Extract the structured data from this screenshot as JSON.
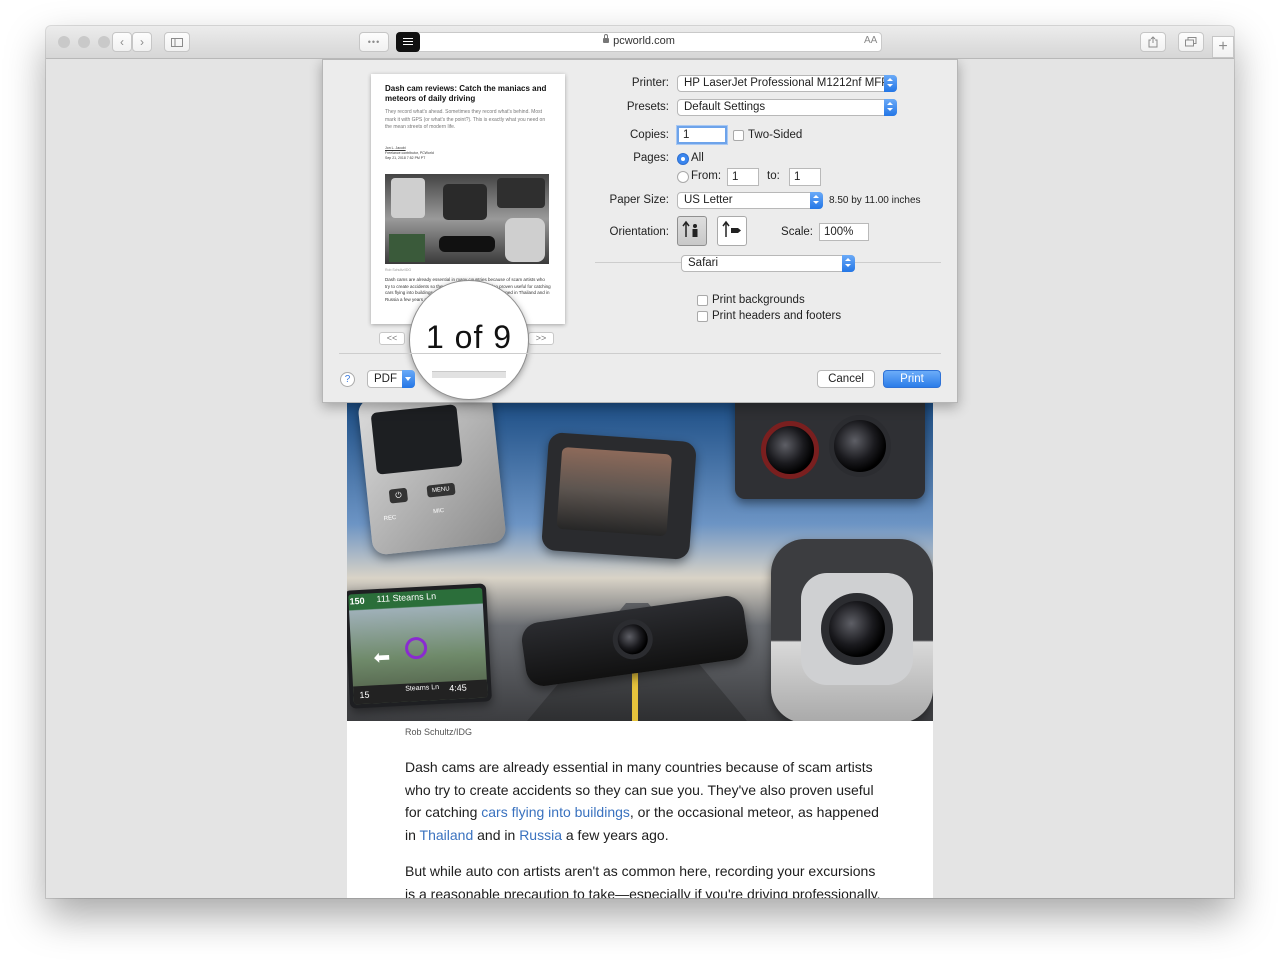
{
  "browser": {
    "url": "pcworld.com",
    "text_size_label": "AA",
    "more_label": "•••",
    "new_tab_label": "+"
  },
  "print_dialog": {
    "preview": {
      "title": "Dash cam reviews: Catch the maniacs and meteors of daily driving",
      "subtitle": "They record what's ahead. Sometimes they record what's behind. Most mark it with GPS (or what's the point?). This is exactly what you need on the mean streets of modern life.",
      "author": "Jon L. Jacobi",
      "author_role": "Freelance contributor, PCWorld",
      "date": "Sep 21, 2018 7:52 PM PT",
      "image_credit": "Rob Schultz/IDG",
      "body": "Dash cams are already essential in many countries because of scam artists who try to create accidents so they can sue you. They've also proven useful for catching cars flying into buildings, or the occasional meteor, as happened in Thailand and in Russia a few years ago."
    },
    "page_indicator": "1 of 9",
    "prev_label": "<<",
    "next_label": ">>",
    "printer_label": "Printer:",
    "printer_value": "HP LaserJet Professional M1212nf MFP",
    "presets_label": "Presets:",
    "presets_value": "Default Settings",
    "copies_label": "Copies:",
    "copies_value": "1",
    "two_sided_label": "Two-Sided",
    "pages_label": "Pages:",
    "pages_all_label": "All",
    "pages_from_label": "From:",
    "pages_from_value": "1",
    "pages_to_label": "to:",
    "pages_to_value": "1",
    "paper_size_label": "Paper Size:",
    "paper_size_value": "US Letter",
    "paper_size_dims": "8.50 by 11.00 inches",
    "orientation_label": "Orientation:",
    "scale_label": "Scale:",
    "scale_value": "100%",
    "section_value": "Safari",
    "print_backgrounds_label": "Print backgrounds",
    "print_headers_label": "Print headers and footers",
    "help_label": "?",
    "pdf_label": "PDF",
    "cancel_label": "Cancel",
    "print_label": "Print"
  },
  "article": {
    "image_credit": "Rob Schultz/IDG",
    "p1_a": "Dash cams are already essential in many countries because of scam artists who try to create accidents so they can sue you. They've also proven useful for catching ",
    "p1_link1": "cars flying into buildings",
    "p1_b": ", or the occasional meteor, as happened in ",
    "p1_link2": "Thailand",
    "p1_c": " and in ",
    "p1_link3": "Russia",
    "p1_d": " a few years ago.",
    "p2": "But while auto con artists aren't as common here, recording your excursions is a reasonable precaution to take—especially if you're driving professionally.",
    "gps_street": "111 Stearns Ln",
    "gps_next": "150",
    "gps_bottom_street": "Stearns Ln",
    "gps_time": "4:45",
    "gps_speed": "15",
    "cam_menu": "MENU",
    "cam_rec": "REC",
    "cam_mic": "MIC"
  },
  "colors": {
    "accent": "#2b7ce9",
    "link": "#3a72bf",
    "traffic_close": "#fc5b57",
    "traffic_min": "#e5bf3c",
    "traffic_max": "#57c038"
  }
}
